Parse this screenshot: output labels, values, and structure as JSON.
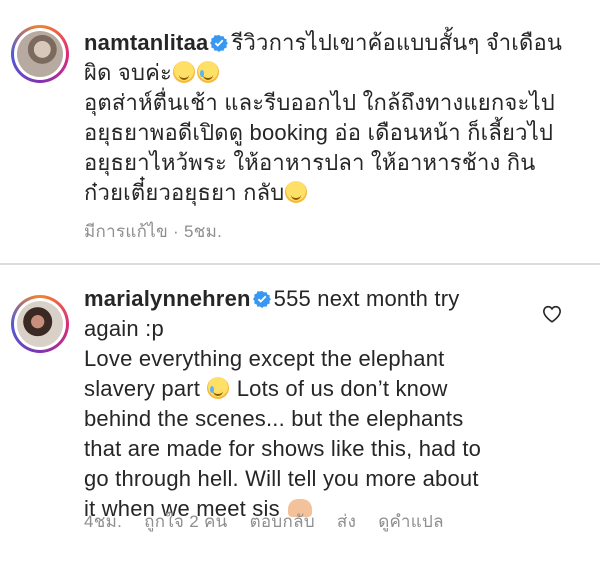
{
  "comments": [
    {
      "username": "namtanlitaa",
      "lines": [
        "รีวิวการไปเขาค้อแบบสั้นๆ จำเดือน",
        "ผิด จบค่ะ",
        "อุตส่าห์ตื่นเช้า และรีบออกไป ใกล้ถึงทางแยกจะไป",
        "อยุธยาพอดีเปิดดู booking อ่อ เดือนหน้า ก็เลี้ยวไป",
        "อยุธยาไหว้พระ ให้อาหารปลา ให้อาหารช้าง กิน",
        "ก๋วยเตี๋ยวอยุธยา กลับ"
      ],
      "meta": {
        "edited": "มีการแก้ไข · 5ชม."
      }
    },
    {
      "username": "marialynnehren",
      "lines": [
        "555 next month try",
        "again :p",
        "Love everything except the elephant",
        "slavery part",
        "Lots of us don’t know",
        "behind the scenes... but the elephants",
        "that are made for shows like this, had to",
        "go through hell. Will tell you more about",
        "it when we meet sis"
      ],
      "meta": {
        "time": "4ชม.",
        "likes": "ถูกใจ 2 คน",
        "reply": "ตอบกลับ",
        "send": "ส่ง",
        "translate": "ดูคำแปล"
      }
    }
  ],
  "colors": {
    "verified": "#3897f0",
    "meta": "#8e8e8e",
    "text": "#262626"
  }
}
